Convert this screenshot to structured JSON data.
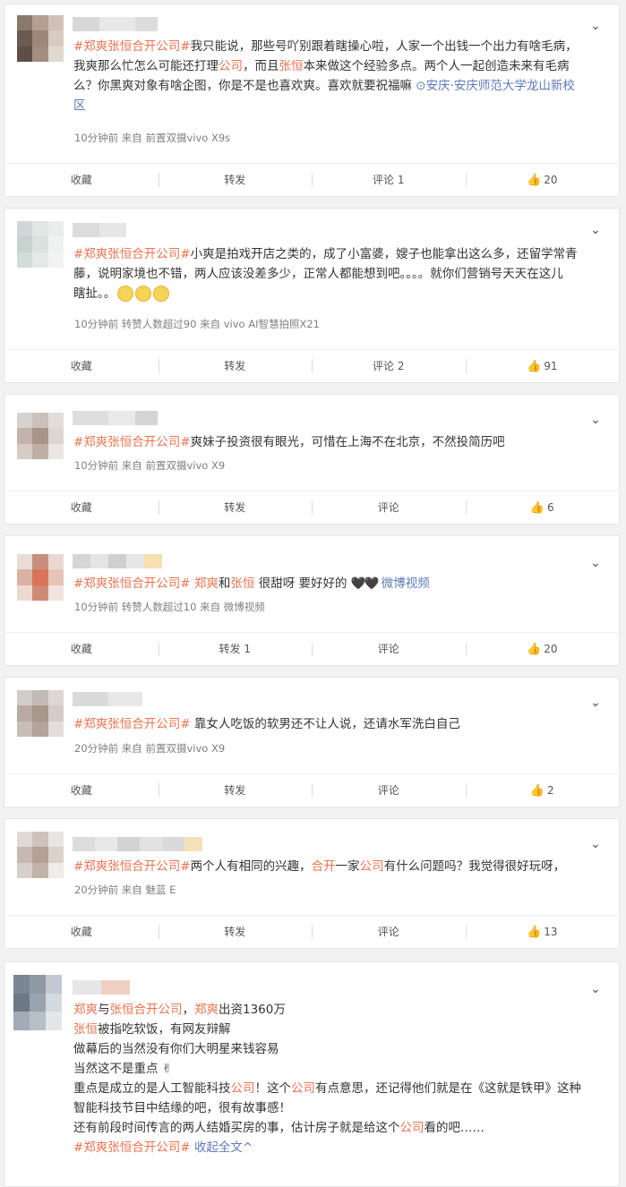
{
  "colors": {
    "accent": "#eb7350",
    "link": "#5d7ab8",
    "meta": "#808080"
  },
  "posts": [
    {
      "lines": [
        [
          {
            "t": "#郑爽张恒合开公司#",
            "c": "tag"
          },
          {
            "t": "我只能说，那些号吖别跟着瞎操心啦，人家一个出钱一个出力有啥毛病，"
          }
        ],
        [
          {
            "t": "我爽那么忙怎么可能还打理"
          },
          {
            "t": "公司",
            "c": "kw"
          },
          {
            "t": "，而且"
          },
          {
            "t": "张恒",
            "c": "kw"
          },
          {
            "t": "本来做这个经验多点。两个人一起创造未来有毛病"
          }
        ],
        [
          {
            "t": "么？你黑爽对象有啥企图，你是不是也喜欢爽。喜欢就要祝福嘛 "
          },
          {
            "t": "⊙安庆·安庆师范大学龙山新校",
            "c": "loc"
          }
        ],
        [
          {
            "t": "区",
            "c": "loc"
          }
        ]
      ],
      "meta": "10分钟前 来自 前置双摄vivo X9s",
      "actions": {
        "collect": "收藏",
        "repost": "转发",
        "comment": "评论 1",
        "like": "20"
      }
    },
    {
      "lines": [
        [
          {
            "t": "#郑爽张恒合开公司#",
            "c": "tag"
          },
          {
            "t": "小爽是拍戏开店之类的，成了小富婆，嫂子也能拿出这么多，还留学常青"
          }
        ],
        [
          {
            "t": "藤，说明家境也不错，两人应该没差多少，正常人都能想到吧。。。。就你们营销号天天在这儿"
          }
        ],
        [
          {
            "t": "瞎扯。。"
          },
          {
            "emoji": 3
          }
        ]
      ],
      "meta": "10分钟前 转赞人数超过90 来自 vivo AI智慧拍照X21",
      "actions": {
        "collect": "收藏",
        "repost": "转发",
        "comment": "评论 2",
        "like": "91"
      }
    },
    {
      "lines": [
        [
          {
            "t": "#郑爽张恒合开公司#",
            "c": "tag"
          },
          {
            "t": "爽妹子投资很有眼光，可惜在上海不在北京，不然投简历吧"
          }
        ]
      ],
      "meta": "10分钟前 来自 前置双摄vivo X9",
      "actions": {
        "collect": "收藏",
        "repost": "转发",
        "comment": "评论",
        "like": "6"
      }
    },
    {
      "lines": [
        [
          {
            "t": "#郑爽张恒合开公司#",
            "c": "tag"
          },
          {
            "t": " "
          },
          {
            "t": "郑爽",
            "c": "kw"
          },
          {
            "t": "和"
          },
          {
            "t": "张恒",
            "c": "kw"
          },
          {
            "t": " 很甜呀 要好好的 "
          },
          {
            "t": "🖤🖤",
            "c": "hearts"
          },
          {
            "t": " 微博视频",
            "c": "loc"
          }
        ]
      ],
      "meta": "10分钟前 转赞人数超过10 来自 微博视频",
      "actions": {
        "collect": "收藏",
        "repost": "转发 1",
        "comment": "评论",
        "like": "20"
      }
    },
    {
      "lines": [
        [
          {
            "t": "#郑爽张恒合开公司#",
            "c": "tag"
          },
          {
            "t": " 靠女人吃饭的软男还不让人说，还请水军洗白自己"
          }
        ]
      ],
      "meta": "20分钟前 来自 前置双摄vivo X9",
      "actions": {
        "collect": "收藏",
        "repost": "转发",
        "comment": "评论",
        "like": "2"
      }
    },
    {
      "lines": [
        [
          {
            "t": "#郑爽张恒合开公司#",
            "c": "tag"
          },
          {
            "t": "两个人有相同的兴趣，"
          },
          {
            "t": "合开",
            "c": "kw"
          },
          {
            "t": "一家"
          },
          {
            "t": "公司",
            "c": "kw"
          },
          {
            "t": "有什么问题吗？我觉得很好玩呀，"
          }
        ]
      ],
      "meta": "20分钟前 来自 魅蓝 E",
      "actions": {
        "collect": "收藏",
        "repost": "转发",
        "comment": "评论",
        "like": "13"
      }
    },
    {
      "lines": [
        [
          {
            "t": "郑爽",
            "c": "kw"
          },
          {
            "t": "与"
          },
          {
            "t": "张恒",
            "c": "kw"
          },
          {
            "t": "合开公司",
            "c": "kw"
          },
          {
            "t": "，"
          },
          {
            "t": "郑爽",
            "c": "kw"
          },
          {
            "t": "出资1360万"
          }
        ],
        [
          {
            "t": "张恒",
            "c": "kw"
          },
          {
            "t": "被指吃软饭，有网友辩解"
          }
        ],
        [
          {
            "t": "做幕后的当然没有你们大明星来钱容易"
          }
        ],
        [
          {
            "t": "当然这不是重点"
          },
          {
            "t": " ✌"
          }
        ],
        [
          {
            "t": "重点是成立的是人工智能科技"
          },
          {
            "t": "公司",
            "c": "kw"
          },
          {
            "t": "！这个"
          },
          {
            "t": "公司",
            "c": "kw"
          },
          {
            "t": "有点意思，还记得他们就是在《这就是铁甲》这种"
          }
        ],
        [
          {
            "t": "智能科技节目中结缘的吧，很有故事感！"
          }
        ],
        [
          {
            "t": "还有前段时间传言的两人结婚买房的事，估计房子就是给这个"
          },
          {
            "t": "公司",
            "c": "kw"
          },
          {
            "t": "看的吧……"
          }
        ],
        [
          {
            "t": "#郑爽张恒合开公司#",
            "c": "tag"
          },
          {
            "t": " 收起全文^",
            "c": "loc"
          }
        ]
      ]
    }
  ]
}
